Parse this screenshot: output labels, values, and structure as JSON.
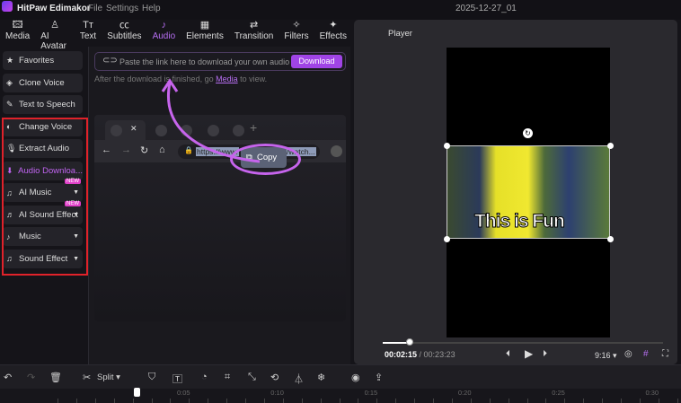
{
  "app": {
    "name": "HitPaw Edimakor",
    "menu": [
      "File",
      "Settings",
      "Help"
    ],
    "project": "2025-12-27_01"
  },
  "toolbar": [
    {
      "label": "Media",
      "icon": "🖾"
    },
    {
      "label": "AI Avatar",
      "icon": "♙"
    },
    {
      "label": "Text",
      "icon": "Tт"
    },
    {
      "label": "Subtitles",
      "icon": "㏄"
    },
    {
      "label": "Audio",
      "icon": "♪"
    },
    {
      "label": "Elements",
      "icon": "▦"
    },
    {
      "label": "Transition",
      "icon": "⇄"
    },
    {
      "label": "Filters",
      "icon": "✧"
    },
    {
      "label": "Effects",
      "icon": "✦"
    }
  ],
  "sidebar": [
    {
      "label": "Favorites",
      "icon": "★"
    },
    {
      "label": "Clone Voice",
      "icon": "◈"
    },
    {
      "label": "Text to Speech",
      "icon": "✎"
    },
    {
      "label": "Change Voice",
      "icon": "◐"
    },
    {
      "label": "Extract Audio",
      "icon": "🎙"
    },
    {
      "label": "Audio Downloa...",
      "icon": "⬇"
    },
    {
      "label": "AI Music",
      "icon": "♫",
      "badge": "NEW"
    },
    {
      "label": "AI Sound Effect",
      "icon": "♬",
      "badge": "NEW"
    },
    {
      "label": "Music",
      "icon": "♪"
    },
    {
      "label": "Sound Effect",
      "icon": "♫"
    }
  ],
  "download": {
    "placeholder": "Paste the link here to download your own audio",
    "button": "Download",
    "hint_pre": "After the download is finished, go ",
    "hint_link": "Media",
    "hint_post": " to view."
  },
  "browser": {
    "url": "https://www.",
    "url_end": "/watch...",
    "copy": "Copy"
  },
  "player": {
    "title": "Player",
    "overlay_text": "This is Fun",
    "current": "00:02:15",
    "total": "/ 00:23:23",
    "ratio": "9:16 ▾",
    "progress": 0.096
  },
  "bottom": {
    "split": "Split ▾"
  },
  "timeline": {
    "ticks": [
      "0:05",
      "0:10",
      "0:15",
      "0:20",
      "0:25",
      "0:30"
    ]
  },
  "colors": {
    "accent": "#a044e6",
    "highlight": "#e0222a"
  }
}
